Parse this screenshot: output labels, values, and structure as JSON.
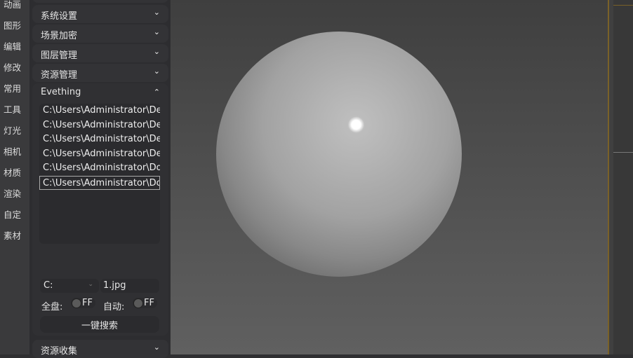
{
  "leftbar": [
    "动画",
    "图形",
    "编辑",
    "修改",
    "常用",
    "工具",
    "灯光",
    "相机",
    "材质",
    "渲染",
    "自定",
    "素材"
  ],
  "sections": [
    "系统设置",
    "场景加密",
    "图层管理",
    "资源管理"
  ],
  "evething": {
    "title": "Evething",
    "files": [
      "C:\\Users\\Administrator\\De",
      "C:\\Users\\Administrator\\De",
      "C:\\Users\\Administrator\\De",
      "C:\\Users\\Administrator\\De",
      "C:\\Users\\Administrator\\Do",
      "C:\\Users\\Administrator\\Do"
    ],
    "drive": "C:",
    "filename": "1.jpg",
    "full_disk_label": "全盘:",
    "full_disk_state": "FF",
    "auto_label": "自动:",
    "auto_state": "FF",
    "search_button": "一键搜索"
  },
  "bottom_section": "资源收集",
  "colors": {
    "accent": "#7a6128"
  }
}
